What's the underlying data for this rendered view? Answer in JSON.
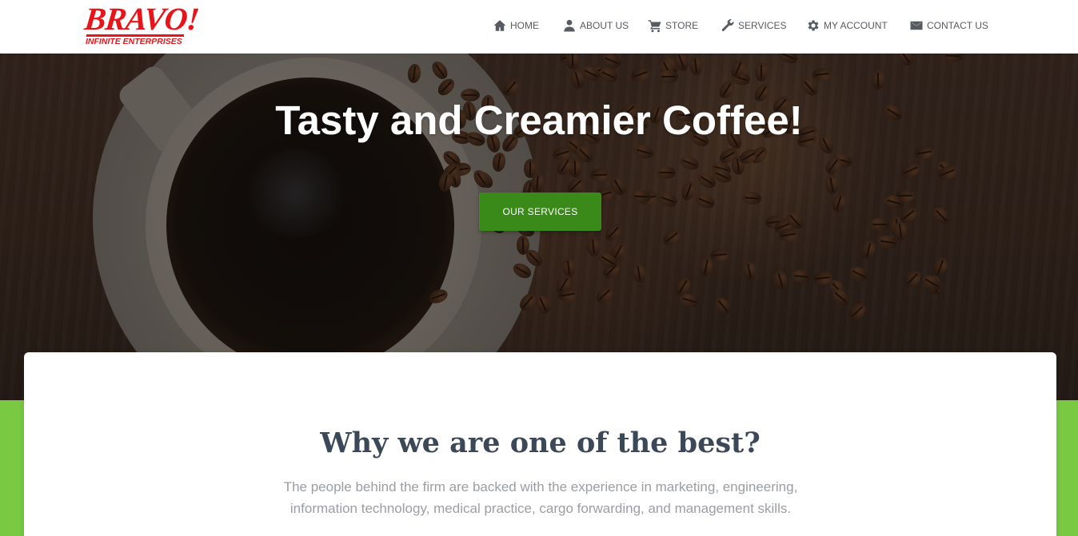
{
  "brand": {
    "name": "BRAVO!",
    "tagline": "INFINITE ENTERPRISES",
    "color": "#e8141a"
  },
  "nav": {
    "items": [
      {
        "label": "HOME",
        "icon": "home-icon"
      },
      {
        "label": "ABOUT US",
        "icon": "user-icon"
      },
      {
        "label": "STORE",
        "icon": "cart-icon"
      },
      {
        "label": "SERVICES",
        "icon": "wrench-icon"
      },
      {
        "label": "MY ACCOUNT",
        "icon": "gear-icon"
      },
      {
        "label": "CONTACT US",
        "icon": "envelope-icon"
      }
    ]
  },
  "hero": {
    "title": "Tasty and Creamier Coffee!",
    "button_label": "OUR SERVICES",
    "button_color": "#3a8a1a"
  },
  "features": {
    "title": "Why we are one of the best?",
    "description": "The people behind the firm are backed with the experience in marketing, engineering, information technology, medical practice, cargo forwarding, and management skills.",
    "band_color": "#7ac943",
    "title_color": "#3b4858"
  }
}
